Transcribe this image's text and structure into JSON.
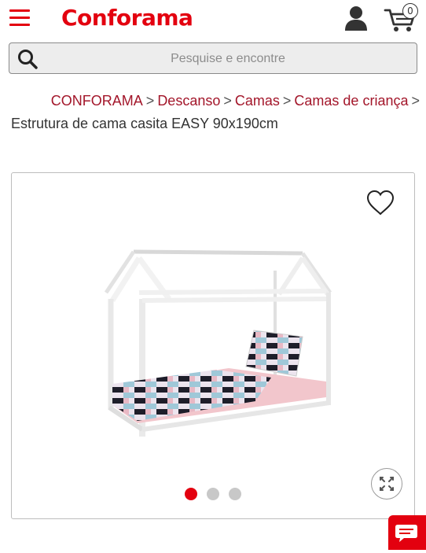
{
  "header": {
    "menu_icon": "hamburger-menu-icon",
    "logo_text": "Conforama",
    "user_icon": "user-icon",
    "cart_icon": "cart-icon",
    "cart_count": "0",
    "brand_color": "#e3000f"
  },
  "search": {
    "placeholder": "Pesquise e encontre",
    "icon": "search-icon"
  },
  "breadcrumb": {
    "items": [
      "CONFORAMA",
      "Descanso",
      "Camas",
      "Camas de criança"
    ],
    "separator": ">",
    "current": "Estrutura de cama casita EASY 90x190cm"
  },
  "product": {
    "favorite_icon": "heart-icon",
    "zoom_icon": "expand-icon",
    "image_count": 3,
    "active_image": 1
  },
  "chat": {
    "icon": "chat-icon"
  }
}
